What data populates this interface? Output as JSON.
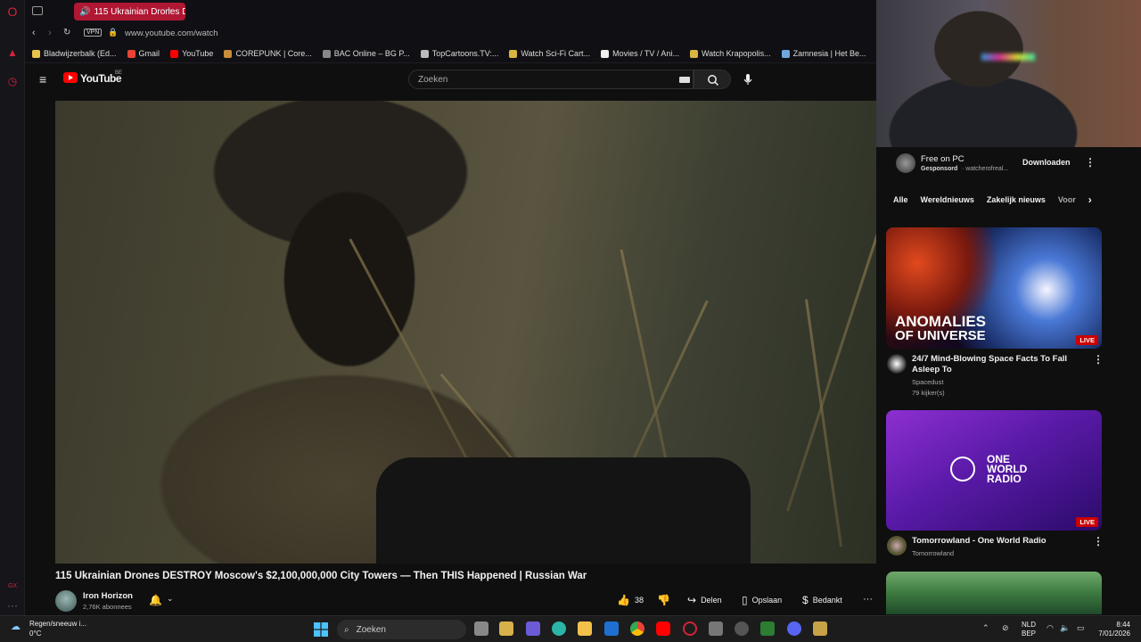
{
  "browser": {
    "tab_title": "115 Ukrainian Drones D",
    "new_tab": "+",
    "vpn_badge": "VPN",
    "url": "www.youtube.com/watch",
    "bookmarks": [
      {
        "label": "Bladwijzerbalk (Ed...",
        "color": "#e8c24a"
      },
      {
        "label": "Gmail",
        "color": "#ea4335"
      },
      {
        "label": "YouTube",
        "color": "#ff0000"
      },
      {
        "label": "COREPUNK | Core...",
        "color": "#c98b3c"
      },
      {
        "label": "BAC Online – BG P...",
        "color": "#888888"
      },
      {
        "label": "TopCartoons.TV:...",
        "color": "#bbbbbb"
      },
      {
        "label": "Watch Sci-Fi Cart...",
        "color": "#d9b640"
      },
      {
        "label": "Movies / TV / Ani...",
        "color": "#eeeeee"
      },
      {
        "label": "Watch Krapopolis...",
        "color": "#d9b640"
      },
      {
        "label": "Zamnesia | Het Be...",
        "color": "#6fa8dc"
      }
    ]
  },
  "youtube": {
    "logo_text": "YouTube",
    "region": "BE",
    "search_placeholder": "Zoeken"
  },
  "video": {
    "title": "115 Ukrainian Drones DESTROY Moscow's $2,100,000,000 City Towers — Then THIS Happened | Russian War",
    "channel": "Iron Horizon",
    "subscribers": "2,76K abonnees",
    "likes": "38",
    "share": "Delen",
    "save": "Opslaan",
    "thanks": "Bedankt",
    "more": "···"
  },
  "sidebar": {
    "sponsor": {
      "title": "Free on PC",
      "label": "Gesponsord",
      "source": "· watcherofreal...",
      "button": "Downloaden"
    },
    "chips": [
      "Alle",
      "Wereldnieuws",
      "Zakelijk nieuws",
      "Voor"
    ],
    "videos": [
      {
        "thumb_text_1": "ANOMALIES",
        "thumb_text_2": "OF UNIVERSE",
        "live": "LIVE",
        "title_1": "24/7 Mind-Blowing Space Facts To Fall",
        "title_2": "Asleep To",
        "channel": "Spacedust",
        "meta": "79 kijker(s)"
      },
      {
        "thumb_text_1": "ONE",
        "thumb_text_2": "WORLD",
        "thumb_text_3": "RADIO",
        "live": "LIVE",
        "title_1": "Tomorrowland - One World Radio",
        "channel": "Tomorrowland"
      }
    ]
  },
  "taskbar": {
    "weather_1": "Regen/sneeuw i...",
    "weather_2": "0°C",
    "search": "Zoeken",
    "lang_1": "NLD",
    "lang_2": "BEP",
    "time": "8:44",
    "date": "7/01/2026"
  }
}
